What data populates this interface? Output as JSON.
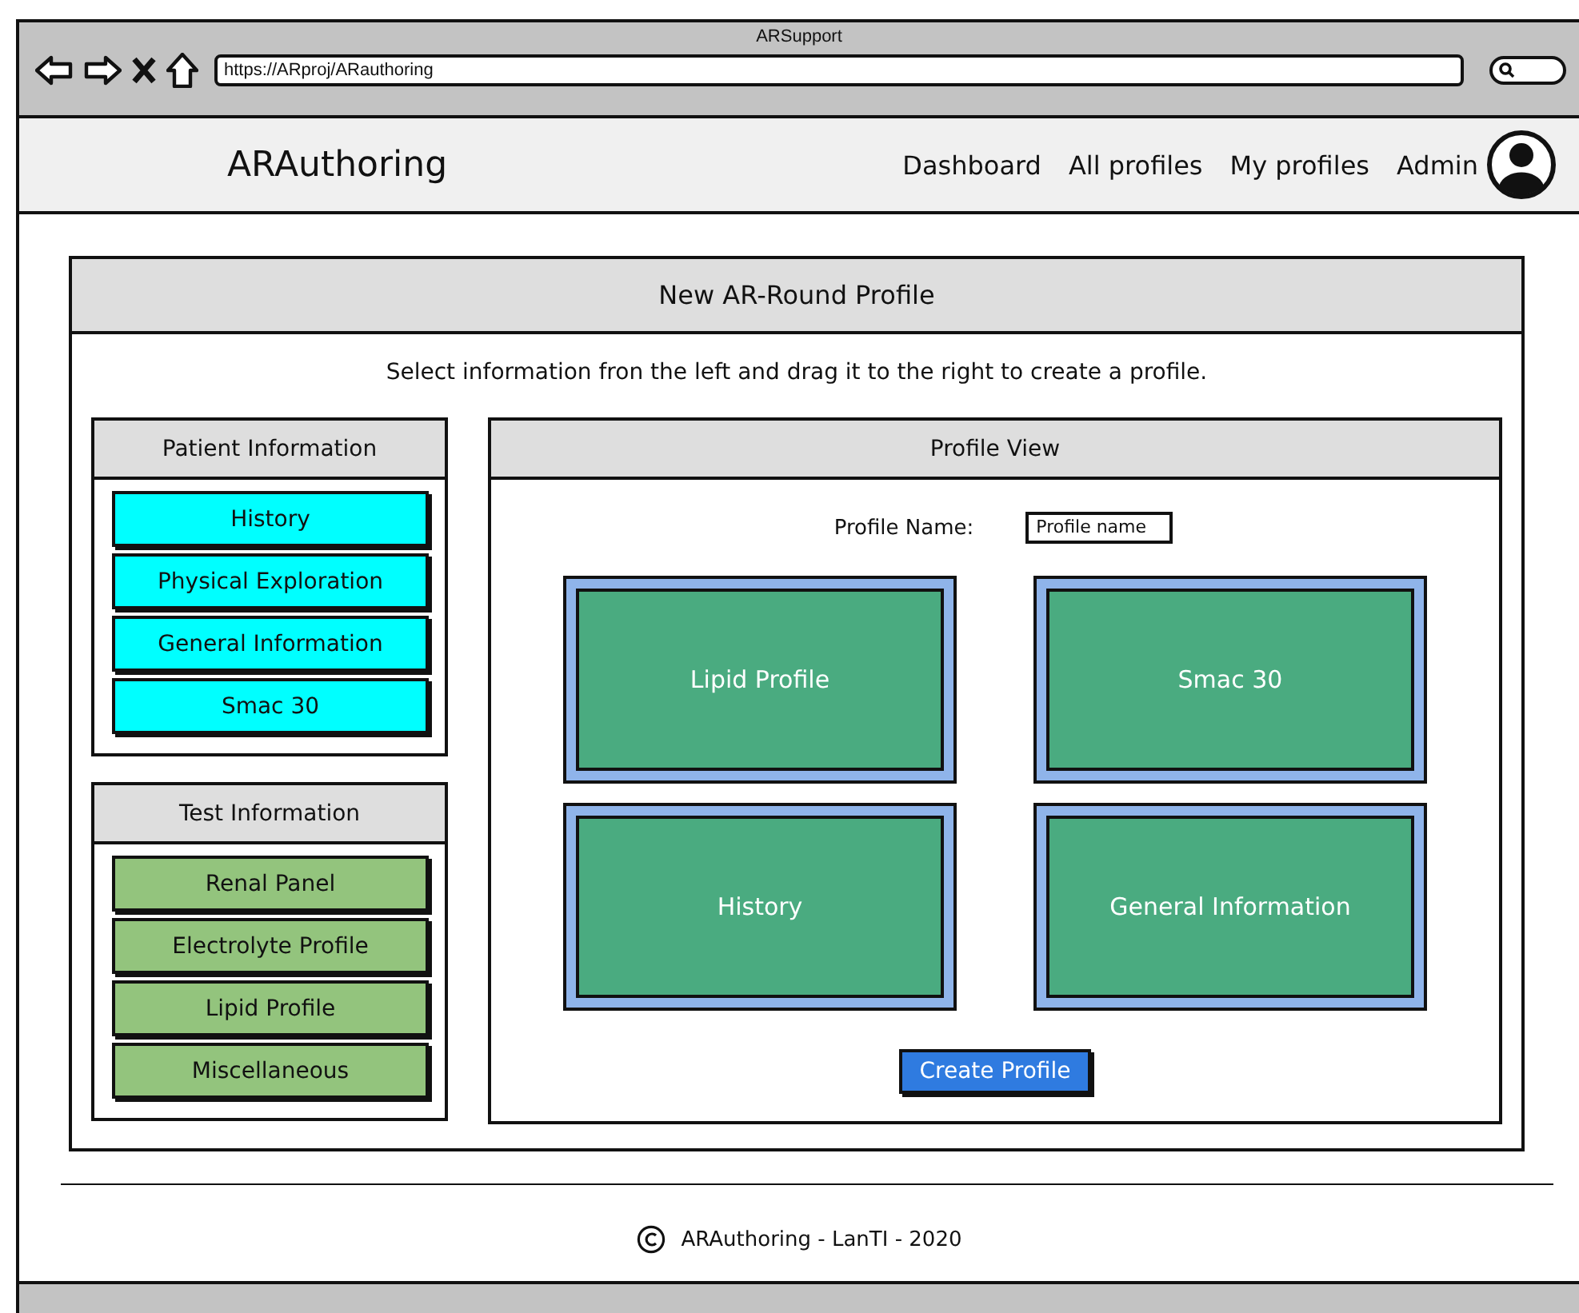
{
  "browser": {
    "title": "ARSupport",
    "url": "https://ARproj/ARauthoring"
  },
  "header": {
    "logo": "ARAuthoring",
    "nav": [
      "Dashboard",
      "All profiles",
      "My profiles",
      "Admin"
    ]
  },
  "card": {
    "title": "New AR-Round Profile",
    "instruction": "Select information fron the left and drag it to the right to create a profile.",
    "patient_information": {
      "title": "Patient Information",
      "items": [
        "History",
        "Physical Exploration",
        "General Information",
        "Smac 30"
      ]
    },
    "test_information": {
      "title": "Test Information",
      "items": [
        "Renal Panel",
        "Electrolyte Profile",
        "Lipid Profile",
        "Miscellaneous"
      ]
    },
    "profile_view": {
      "title": "Profile View",
      "name_label": "Profile Name:",
      "name_value": "Profile name",
      "tiles": [
        "Lipid Profile",
        "Smac 30",
        "History",
        "General Information"
      ],
      "button": "Create Profile"
    }
  },
  "footer": {
    "text": "ARAuthoring - LanTI - 2020"
  }
}
